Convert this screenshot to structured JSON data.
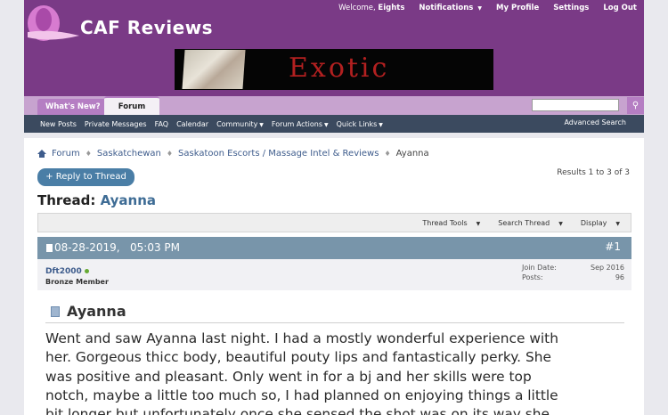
{
  "header": {
    "site_name": "CAF Reviews",
    "welcome": "Welcome,",
    "username": "Eights",
    "notifications": "Notifications",
    "my_profile": "My Profile",
    "settings": "Settings",
    "logout": "Log Out",
    "banner_text": "Exotic"
  },
  "nav": {
    "whats_new": "What's New?",
    "forum_tab": "Forum",
    "sub": [
      "New Posts",
      "Private Messages",
      "FAQ",
      "Calendar",
      "Community",
      "Forum Actions",
      "Quick Links"
    ],
    "advanced_search": "Advanced Search"
  },
  "breadcrumb": {
    "items": [
      "Forum",
      "Saskatchewan",
      "Saskatoon Escorts / Massage Intel & Reviews",
      "Ayanna"
    ]
  },
  "thread": {
    "reply_label": "+ Reply to Thread",
    "results": "Results 1 to 3 of 3",
    "title_prefix": "Thread:",
    "title": "Ayanna",
    "tools": [
      "Thread Tools",
      "Search Thread",
      "Display"
    ]
  },
  "post": {
    "date": "08-28-2019,",
    "time": "05:03 PM",
    "number": "#1",
    "author": "Dft2000",
    "rank": "Bronze Member",
    "join_label": "Join Date:",
    "join_value": "Sep 2016",
    "posts_label": "Posts:",
    "posts_value": "96",
    "title": "Ayanna",
    "body_lines": [
      "Went and saw Ayanna last night. I had a mostly wonderful experience with",
      "her. Gorgeous thicc body, beautiful pouty lips and fantastically perky. She",
      "was positive and pleasant. Only went in for a bj and her skills were top",
      "notch, maybe a little too much so, I had planned on enjoying things a little",
      "bit longer but unfortunately once she sensed the shot was on its way she"
    ]
  }
}
